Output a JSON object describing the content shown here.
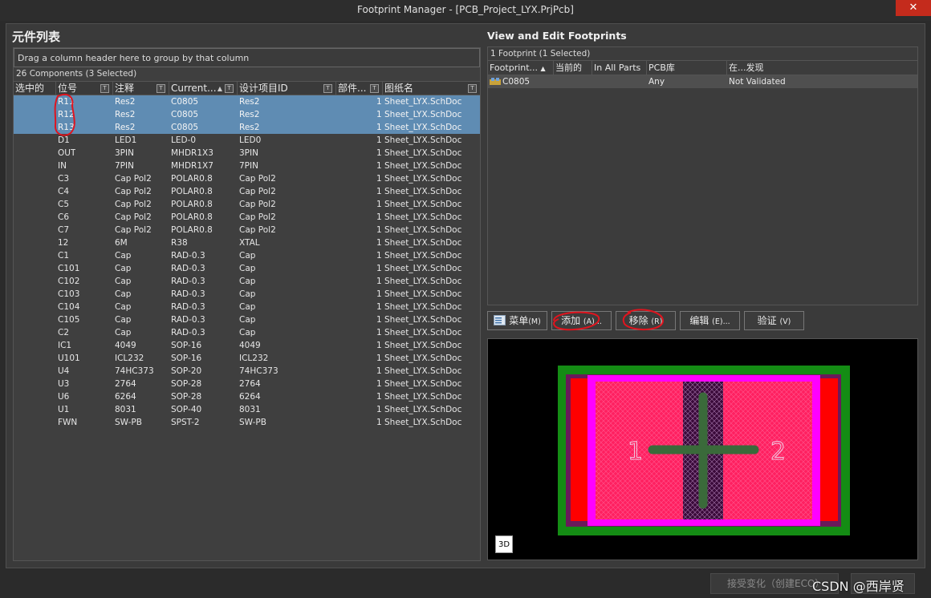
{
  "window": {
    "title": "Footprint Manager - [PCB_Project_LYX.PrjPcb]",
    "close_glyph": "✕"
  },
  "left": {
    "heading": "元件列表",
    "group_hint": "Drag a column header here to group by that column",
    "count": "26 Components (3 Selected)",
    "columns": [
      "选中的",
      "位号",
      "注释",
      "Current...",
      "设计项目ID",
      "部件...",
      "图纸名"
    ],
    "rows": [
      {
        "ref": "R11",
        "comment": "Res2",
        "current": "C0805",
        "design_id": "Res2",
        "parts": "1",
        "sheet": "Sheet_LYX.SchDoc",
        "selected": true
      },
      {
        "ref": "R12",
        "comment": "Res2",
        "current": "C0805",
        "design_id": "Res2",
        "parts": "1",
        "sheet": "Sheet_LYX.SchDoc",
        "selected": true
      },
      {
        "ref": "R13",
        "comment": "Res2",
        "current": "C0805",
        "design_id": "Res2",
        "parts": "1",
        "sheet": "Sheet_LYX.SchDoc",
        "selected": true
      },
      {
        "ref": "D1",
        "comment": "LED1",
        "current": "LED-0",
        "design_id": "LED0",
        "parts": "1",
        "sheet": "Sheet_LYX.SchDoc",
        "selected": false
      },
      {
        "ref": "OUT",
        "comment": "3PIN",
        "current": "MHDR1X3",
        "design_id": "3PIN",
        "parts": "1",
        "sheet": "Sheet_LYX.SchDoc",
        "selected": false
      },
      {
        "ref": "IN",
        "comment": "7PIN",
        "current": "MHDR1X7",
        "design_id": "7PIN",
        "parts": "1",
        "sheet": "Sheet_LYX.SchDoc",
        "selected": false
      },
      {
        "ref": "C3",
        "comment": "Cap Pol2",
        "current": "POLAR0.8",
        "design_id": "Cap Pol2",
        "parts": "1",
        "sheet": "Sheet_LYX.SchDoc",
        "selected": false
      },
      {
        "ref": "C4",
        "comment": "Cap Pol2",
        "current": "POLAR0.8",
        "design_id": "Cap Pol2",
        "parts": "1",
        "sheet": "Sheet_LYX.SchDoc",
        "selected": false
      },
      {
        "ref": "C5",
        "comment": "Cap Pol2",
        "current": "POLAR0.8",
        "design_id": "Cap Pol2",
        "parts": "1",
        "sheet": "Sheet_LYX.SchDoc",
        "selected": false
      },
      {
        "ref": "C6",
        "comment": "Cap Pol2",
        "current": "POLAR0.8",
        "design_id": "Cap Pol2",
        "parts": "1",
        "sheet": "Sheet_LYX.SchDoc",
        "selected": false
      },
      {
        "ref": "C7",
        "comment": "Cap Pol2",
        "current": "POLAR0.8",
        "design_id": "Cap Pol2",
        "parts": "1",
        "sheet": "Sheet_LYX.SchDoc",
        "selected": false
      },
      {
        "ref": "12",
        "comment": "6M",
        "current": "R38",
        "design_id": "XTAL",
        "parts": "1",
        "sheet": "Sheet_LYX.SchDoc",
        "selected": false
      },
      {
        "ref": "C1",
        "comment": "Cap",
        "current": "RAD-0.3",
        "design_id": "Cap",
        "parts": "1",
        "sheet": "Sheet_LYX.SchDoc",
        "selected": false
      },
      {
        "ref": "C101",
        "comment": "Cap",
        "current": "RAD-0.3",
        "design_id": "Cap",
        "parts": "1",
        "sheet": "Sheet_LYX.SchDoc",
        "selected": false
      },
      {
        "ref": "C102",
        "comment": "Cap",
        "current": "RAD-0.3",
        "design_id": "Cap",
        "parts": "1",
        "sheet": "Sheet_LYX.SchDoc",
        "selected": false
      },
      {
        "ref": "C103",
        "comment": "Cap",
        "current": "RAD-0.3",
        "design_id": "Cap",
        "parts": "1",
        "sheet": "Sheet_LYX.SchDoc",
        "selected": false
      },
      {
        "ref": "C104",
        "comment": "Cap",
        "current": "RAD-0.3",
        "design_id": "Cap",
        "parts": "1",
        "sheet": "Sheet_LYX.SchDoc",
        "selected": false
      },
      {
        "ref": "C105",
        "comment": "Cap",
        "current": "RAD-0.3",
        "design_id": "Cap",
        "parts": "1",
        "sheet": "Sheet_LYX.SchDoc",
        "selected": false
      },
      {
        "ref": "C2",
        "comment": "Cap",
        "current": "RAD-0.3",
        "design_id": "Cap",
        "parts": "1",
        "sheet": "Sheet_LYX.SchDoc",
        "selected": false
      },
      {
        "ref": "IC1",
        "comment": "4049",
        "current": "SOP-16",
        "design_id": "4049",
        "parts": "1",
        "sheet": "Sheet_LYX.SchDoc",
        "selected": false
      },
      {
        "ref": "U101",
        "comment": "ICL232",
        "current": "SOP-16",
        "design_id": "ICL232",
        "parts": "1",
        "sheet": "Sheet_LYX.SchDoc",
        "selected": false
      },
      {
        "ref": "U4",
        "comment": "74HC373",
        "current": "SOP-20",
        "design_id": "74HC373",
        "parts": "1",
        "sheet": "Sheet_LYX.SchDoc",
        "selected": false
      },
      {
        "ref": "U3",
        "comment": "2764",
        "current": "SOP-28",
        "design_id": "2764",
        "parts": "1",
        "sheet": "Sheet_LYX.SchDoc",
        "selected": false
      },
      {
        "ref": "U6",
        "comment": "6264",
        "current": "SOP-28",
        "design_id": "6264",
        "parts": "1",
        "sheet": "Sheet_LYX.SchDoc",
        "selected": false
      },
      {
        "ref": "U1",
        "comment": "8031",
        "current": "SOP-40",
        "design_id": "8031",
        "parts": "1",
        "sheet": "Sheet_LYX.SchDoc",
        "selected": false
      },
      {
        "ref": "FWN",
        "comment": "SW-PB",
        "current": "SPST-2",
        "design_id": "SW-PB",
        "parts": "1",
        "sheet": "Sheet_LYX.SchDoc",
        "selected": false
      }
    ]
  },
  "right": {
    "heading": "View and Edit Footprints",
    "count": "1 Footprint (1 Selected)",
    "columns": [
      "Footprint...",
      "当前的",
      "In All Parts",
      "PCB库",
      "在...发现"
    ],
    "footprints": [
      {
        "name": "C0805",
        "current": "",
        "in_all_parts": "",
        "pcb_lib": "Any",
        "found_in": "Not Validated"
      }
    ],
    "buttons": {
      "menu": {
        "label": "菜单",
        "accel": "(M)"
      },
      "add": {
        "label": "添加",
        "accel": "(A)..."
      },
      "remove": {
        "label": "移除",
        "accel": "(R)"
      },
      "edit": {
        "label": "编辑",
        "accel": "(E)..."
      },
      "validate": {
        "label": "验证",
        "accel": "(V)"
      }
    },
    "preview": {
      "pad_left": "1",
      "pad_right": "2",
      "badge_3d": "3D"
    }
  },
  "bottom": {
    "accept": "接受变化（创建ECO）",
    "watermark": "CSDN @西岸贤"
  },
  "colors": {
    "selection": "#5f8cb3",
    "annotation": "#e0141e",
    "pcb_pad": "#ff0000",
    "pcb_body": "#ff00ff",
    "pcb_outline": "#1a8a1a"
  }
}
